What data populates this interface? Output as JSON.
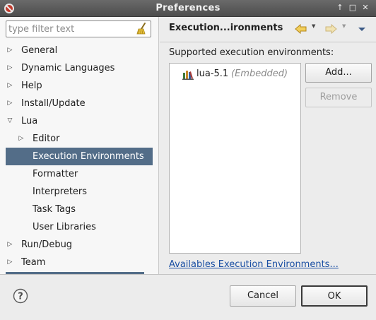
{
  "window": {
    "title": "Preferences",
    "buttons": [
      "pin-icon",
      "maximize-icon",
      "close-icon"
    ],
    "glyphs": {
      "pin": "↑",
      "maximize": "□",
      "close": "✕"
    }
  },
  "filter": {
    "placeholder": "type filter text",
    "value": ""
  },
  "tree": {
    "items": [
      {
        "label": "General",
        "level": 0,
        "expander": "collapsed"
      },
      {
        "label": "Dynamic Languages",
        "level": 0,
        "expander": "collapsed"
      },
      {
        "label": "Help",
        "level": 0,
        "expander": "collapsed"
      },
      {
        "label": "Install/Update",
        "level": 0,
        "expander": "collapsed"
      },
      {
        "label": "Lua",
        "level": 0,
        "expander": "expanded"
      },
      {
        "label": "Editor",
        "level": 1,
        "expander": "collapsed"
      },
      {
        "label": "Execution Environments",
        "level": 1,
        "expander": "none",
        "selected": true
      },
      {
        "label": "Formatter",
        "level": 1,
        "expander": "none"
      },
      {
        "label": "Interpreters",
        "level": 1,
        "expander": "none"
      },
      {
        "label": "Task Tags",
        "level": 1,
        "expander": "none"
      },
      {
        "label": "User Libraries",
        "level": 1,
        "expander": "none"
      },
      {
        "label": "Run/Debug",
        "level": 0,
        "expander": "collapsed"
      },
      {
        "label": "Team",
        "level": 0,
        "expander": "collapsed"
      }
    ]
  },
  "page": {
    "header": "Execution...ironments",
    "section_label": "Supported execution environments:",
    "environments": [
      {
        "name": "lua-5.1",
        "tag": "(Embedded)"
      }
    ],
    "add_label": "Add...",
    "remove_label": "Remove",
    "link_label": "Availables Execution Environments..."
  },
  "footer": {
    "cancel_label": "Cancel",
    "ok_label": "OK"
  },
  "colors": {
    "selection": "#536d88",
    "titlebar": "#5a5a5a",
    "link": "#1a4fa3",
    "nav_arrow": "#e8b43a"
  }
}
